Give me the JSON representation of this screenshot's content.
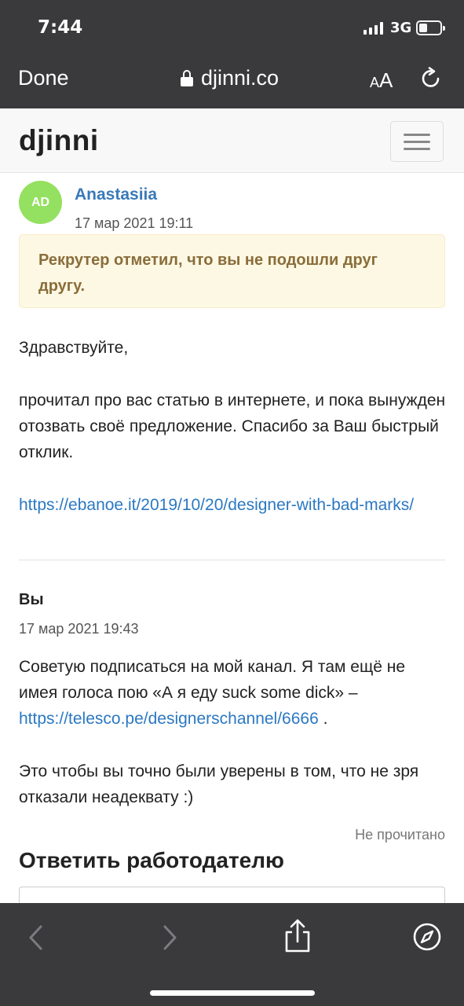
{
  "status_bar": {
    "time": "7:44",
    "network": "3G"
  },
  "browser": {
    "done_label": "Done",
    "url": "djinni.co",
    "text_size_small": "A",
    "text_size_large": "A"
  },
  "site": {
    "logo": "djinni"
  },
  "message1": {
    "avatar_initials": "AD",
    "sender": "Anastasiia",
    "date": "17 мар 2021 19:11",
    "alert": "Рекрутер отметил, что вы не подошли друг другу.",
    "greeting": "Здравствуйте,",
    "body": "прочитал про вас статью в интернете, и пока вынужден отозвать своё предложение. Спасибо за Ваш быстрый отклик.",
    "link": "https://ebanoe.it/2019/10/20/designer-with-bad-marks/"
  },
  "message2": {
    "sender": "Вы",
    "date": "17 мар 2021 19:43",
    "body_before_link": "Советую подписаться на мой канал. Я там ещё не имея голоса пою «А я еду suck some dick» –",
    "link": "https://telesco.pe/designerschannel/6666",
    "body_after_link": ".",
    "body2": "Это чтобы вы точно были уверены в том, что не зря отказали неадеквату :)",
    "status": "Не прочитано"
  },
  "reply": {
    "title": "Ответить работодателю"
  },
  "colors": {
    "chrome": "#3a3a3c",
    "link": "#2b78c2",
    "avatar": "#94e060",
    "alert_bg": "#fcf8e3",
    "alert_text": "#8a6d3b"
  }
}
